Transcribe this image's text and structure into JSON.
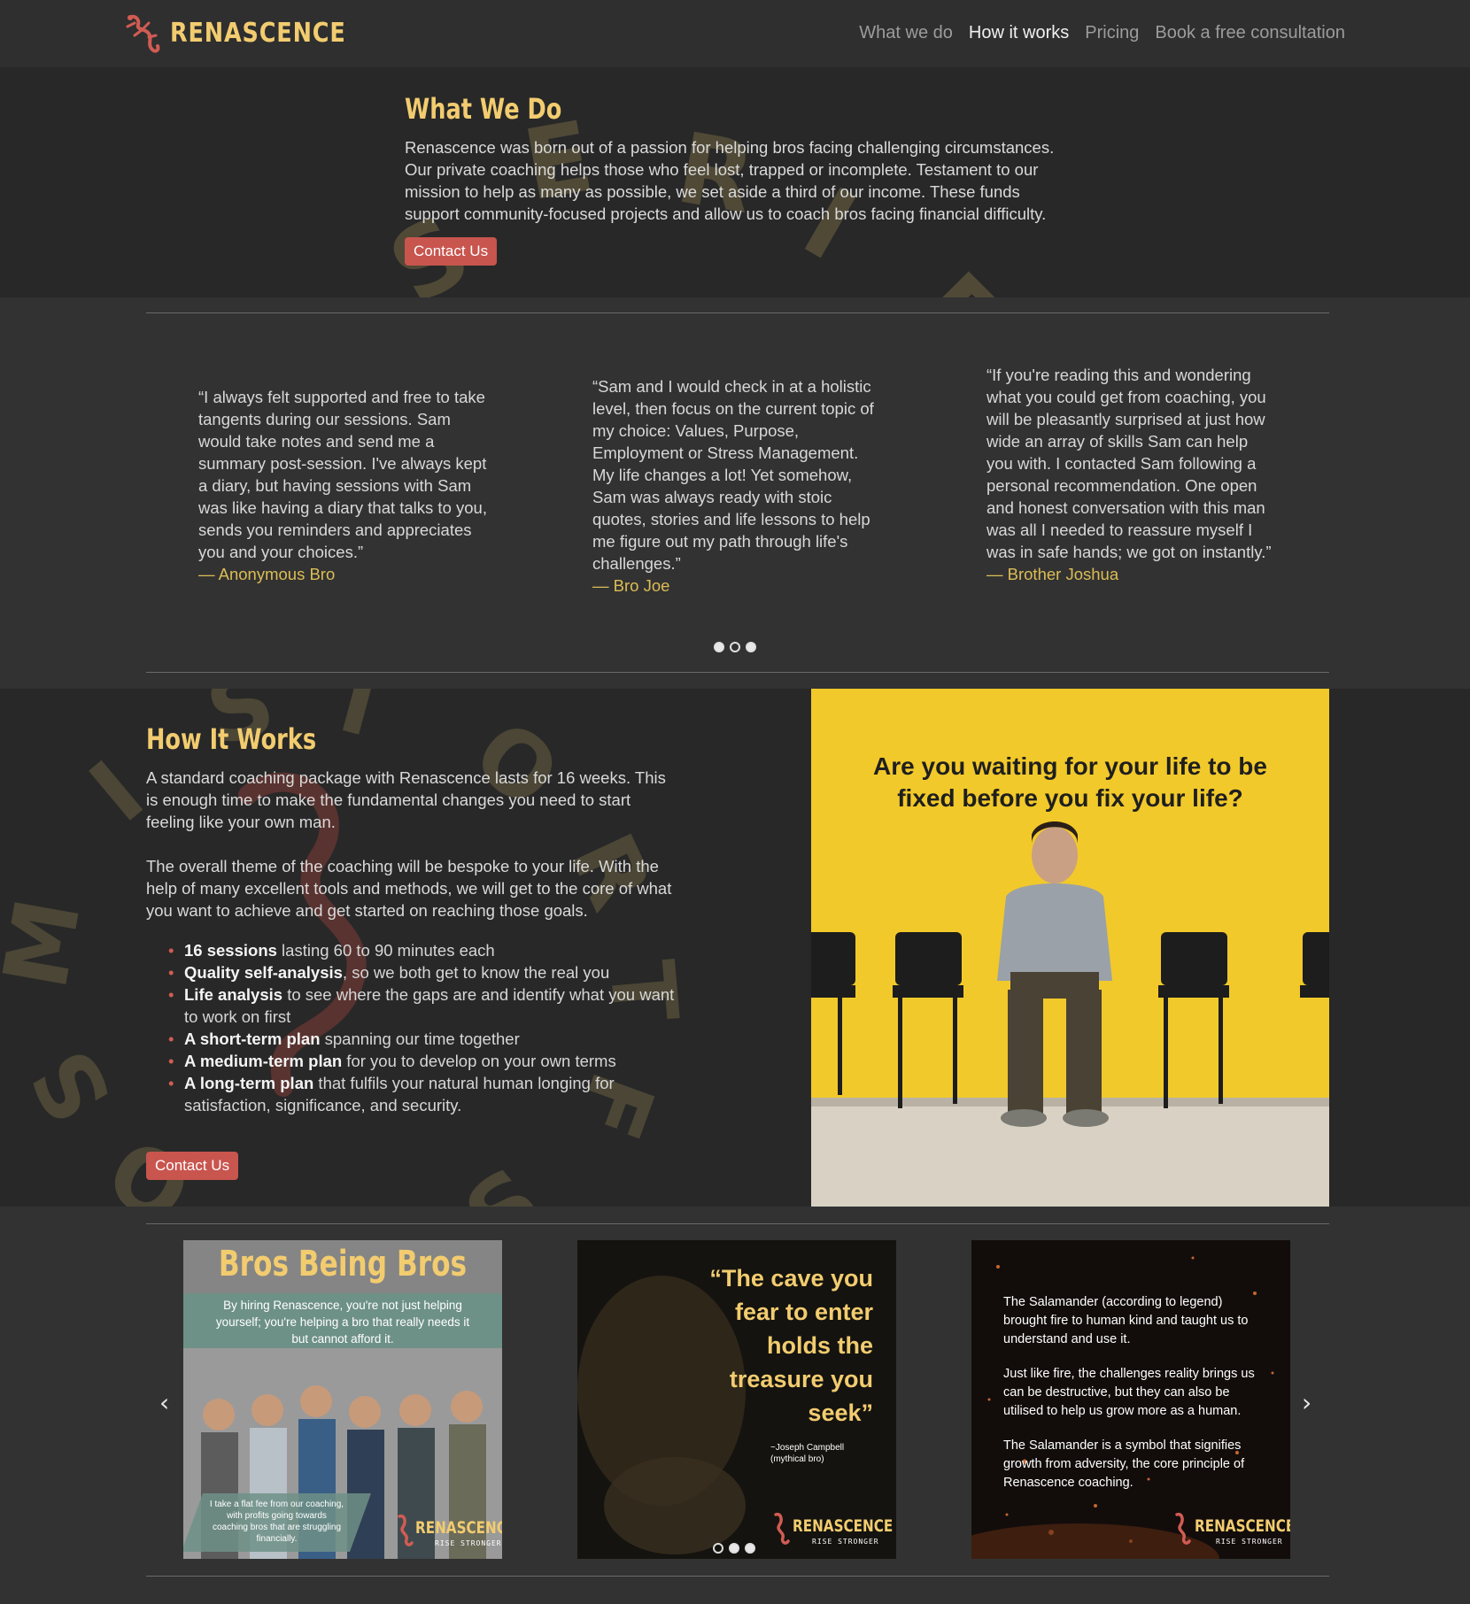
{
  "nav": {
    "brand": "RENASCENCE",
    "links": [
      "What we do",
      "How it works",
      "Pricing",
      "Book a free consultation"
    ],
    "active_index": 1
  },
  "what_we_do": {
    "title": "What We Do",
    "body": "Renascence was born out of a passion for helping bros facing challenging circumstances. Our private coaching helps those who feel lost, trapped or incomplete. Testament to our mission to help as many as possible, we set aside a third of our income. These funds support community-focused projects and allow us to coach bros facing financial difficulty.",
    "button": "Contact Us"
  },
  "testimonials": [
    {
      "quote": "“I always felt supported and free to take tangents during our sessions. Sam would take notes and send me a summary post-session. I've always kept a diary, but having sessions with Sam was like having a diary that talks to you, sends you reminders and appreciates you and your choices.”",
      "author": "— Anonymous Bro"
    },
    {
      "quote": "“Sam and I would check in at a holistic level, then focus on the current topic of my choice: Values, Purpose, Employment or Stress Management. My life changes a lot! Yet somehow, Sam was always ready with stoic quotes, stories and life lessons to help me figure out my path through life's challenges.”",
      "author": "— Bro Joe"
    },
    {
      "quote": "“If you're reading this and wondering what you could get from coaching, you will be pleasantly surprised at just how wide an array of skills Sam can help you with. I contacted Sam following a personal recommendation. One open and honest conversation with this man was all I needed to reassure myself I was in safe hands; we got on instantly.”",
      "author": "— Brother Joshua"
    }
  ],
  "testimonial_dots": {
    "count": 3,
    "active": 1
  },
  "how_it_works": {
    "title": "How It Works",
    "para1": "A standard coaching package with Renascence lasts for 16 weeks. This is enough time to make the fundamental changes you need to start feeling like your own man.",
    "para2": "The overall theme of the coaching will be bespoke to your life. With the help of many excellent tools and methods, we will get to the core of what you want to achieve and get started on reaching those goals.",
    "list": [
      {
        "bold": "16 sessions",
        "rest": " lasting 60 to 90 minutes each"
      },
      {
        "bold": "Quality self-analysis",
        "rest": ", so we both get to know the real you"
      },
      {
        "bold": "Life analysis",
        "rest": " to see where the gaps are and identify what you want to work on first"
      },
      {
        "bold": "A short-term plan",
        "rest": " spanning our time together"
      },
      {
        "bold": "A medium-term plan",
        "rest": " for you to develop on your own terms"
      },
      {
        "bold": "A long-term plan",
        "rest": " that fulfils your natural human longing for satisfaction, significance, and security."
      }
    ],
    "button": "Contact Us",
    "image_caption": "Are you waiting for your life to be fixed before you fix your life?"
  },
  "carousel": {
    "card1": {
      "title": "Bros Being Bros",
      "text": "By hiring Renascence, you're not just helping yourself; you're helping a bro that really needs it but cannot afford it.",
      "note": "I take a flat fee from our coaching, with profits going towards coaching bros that are struggling financially."
    },
    "card2": {
      "quote": "“The cave you fear to enter holds the treasure you seek”",
      "attribution_line1": "~Joseph Campbell",
      "attribution_line2": "(mythical bro)"
    },
    "card3": {
      "p1": "The Salamander (according to legend) brought fire to human kind and taught us to understand and use it.",
      "p2": "Just like fire, the challenges reality brings us can be destructive, but they can also be utilised to help us grow more as a human.",
      "p3": "The Salamander is a symbol that signifies growth from adversity, the core principle of Renascence coaching."
    },
    "brand": "RENASCENCE",
    "tagline": "RISE STRONGER",
    "dots": {
      "count": 3,
      "active": 1
    }
  },
  "colors": {
    "accent": "#f2cc6f",
    "button": "#c8554e",
    "image_bg": "#f2c92a"
  }
}
